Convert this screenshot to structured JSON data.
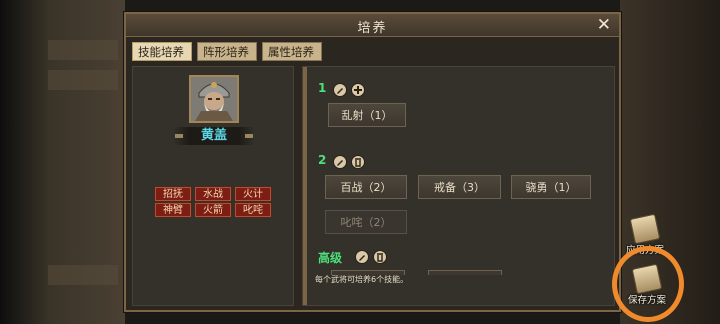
{
  "dialog": {
    "title": "培养"
  },
  "tabs": [
    {
      "label": "技能培养",
      "active": true
    },
    {
      "label": "阵形培养"
    },
    {
      "label": "属性培养"
    }
  ],
  "general": {
    "name": "黄盖"
  },
  "skills": [
    "招抚",
    "水战",
    "火计",
    "神臂",
    "火箭",
    "叱咤"
  ],
  "rows": [
    {
      "label": "1",
      "slots": [
        "乱射（1）"
      ]
    },
    {
      "label": "2",
      "slots": [
        "百战（2）",
        "戒备（3）",
        "骁勇（1）",
        "叱咤（2）"
      ]
    },
    {
      "label": "高级",
      "slots": []
    }
  ],
  "hint": "每个武将可培养6个技能。",
  "side": {
    "apply": "应用方案",
    "save": "保存方案"
  },
  "colors": {
    "accent": "#4ce07a",
    "name": "#5ad7e6",
    "skill_bg": "#7d1d13",
    "highlight_ring": "#f08a2a"
  }
}
